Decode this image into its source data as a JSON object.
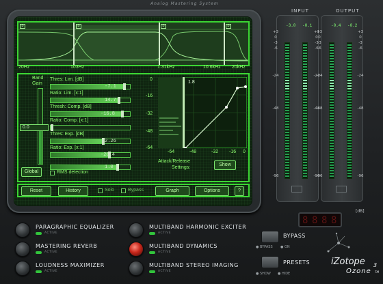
{
  "window": {
    "system_title": "Analog Mastering System"
  },
  "eq": {
    "freq_labels": [
      "20Hz",
      "103Hz",
      "1.31kHz",
      "10.6kHz",
      "20kHz"
    ],
    "band_markers": [
      "b",
      "b",
      "b",
      "b"
    ]
  },
  "band_gain": {
    "label_line1": "Band",
    "label_line2": "Gain",
    "value": "0.0",
    "global_button": "Global"
  },
  "sliders": [
    {
      "label": "Thres: Lim. [dB]",
      "value": "-7.1",
      "level": 0.93
    },
    {
      "label": "Ratio: Lim. [x:1]",
      "value": "14.7",
      "level": 0.86
    },
    {
      "label": "Thresh: Comp. [dB]",
      "value": "-16.8",
      "level": 0.9
    },
    {
      "label": "Ratio: Comp. [x:1]",
      "value": "",
      "level": 0.0
    },
    {
      "label": "Thres: Exp. [dB]",
      "value": "2.26",
      "level": 0.66
    },
    {
      "label": "Ratio: Exp. [x:1]",
      "value": "-28.4",
      "level": 0.74
    },
    {
      "label": "",
      "value": "1.0",
      "level": 0.84
    }
  ],
  "rms": {
    "label": "RMS detection"
  },
  "graph": {
    "y_ticks": [
      "0",
      "-16",
      "-32",
      "-48",
      "-64"
    ],
    "x_ticks": [
      "-64",
      "-48",
      "-32",
      "-16",
      "0"
    ],
    "top_value": "1.8",
    "caption_line1": "Attack/Release",
    "caption_line2": "Settings:",
    "show_button": "Show"
  },
  "bottom_buttons": {
    "reset": "Reset",
    "history": "History",
    "solo": "Solo",
    "bypass": "Bypass",
    "graph": "Graph",
    "options": "Options",
    "help": "?"
  },
  "meters": {
    "input": {
      "title": "INPUT",
      "left": "-3.0",
      "right": "-0.1"
    },
    "output": {
      "title": "OUTPUT",
      "left": "-0.4",
      "right": "-0.2"
    },
    "scale": [
      "+3",
      "0",
      "-3",
      "-6",
      "-24",
      "-48",
      "-96"
    ],
    "unit": "[dB]"
  },
  "readout": {
    "digits": "8888"
  },
  "modules": [
    {
      "name": "PARAGRAPHIC EQUALIZER",
      "status": "ACTIVE",
      "on": false
    },
    {
      "name": "MASTERING REVERB",
      "status": "ACTIVE",
      "on": false
    },
    {
      "name": "LOUDNESS MAXIMIZER",
      "status": "ACTIVE",
      "on": false
    },
    {
      "name": "MULTIBAND HARMONIC EXCITER",
      "status": "ACTIVE",
      "on": false
    },
    {
      "name": "MULTIBAND DYNAMICS",
      "status": "ACTIVE",
      "on": true
    },
    {
      "name": "MULTIBAND STEREO IMAGING",
      "status": "ACTIVE",
      "on": false
    }
  ],
  "side": {
    "bypass": "BYPASS",
    "bypass_opt": "BYPASS",
    "on_opt": "ON",
    "presets": "PRESETS",
    "show_opt": "SHOW",
    "hide_opt": "HIDE"
  },
  "brand": {
    "name": "iZotope",
    "product": "Ozone",
    "version": "3",
    "tm": "TM"
  },
  "colors": {
    "screen_green": "#3bd633",
    "led_green": "#2ec35d",
    "active_red": "#c8271b"
  }
}
